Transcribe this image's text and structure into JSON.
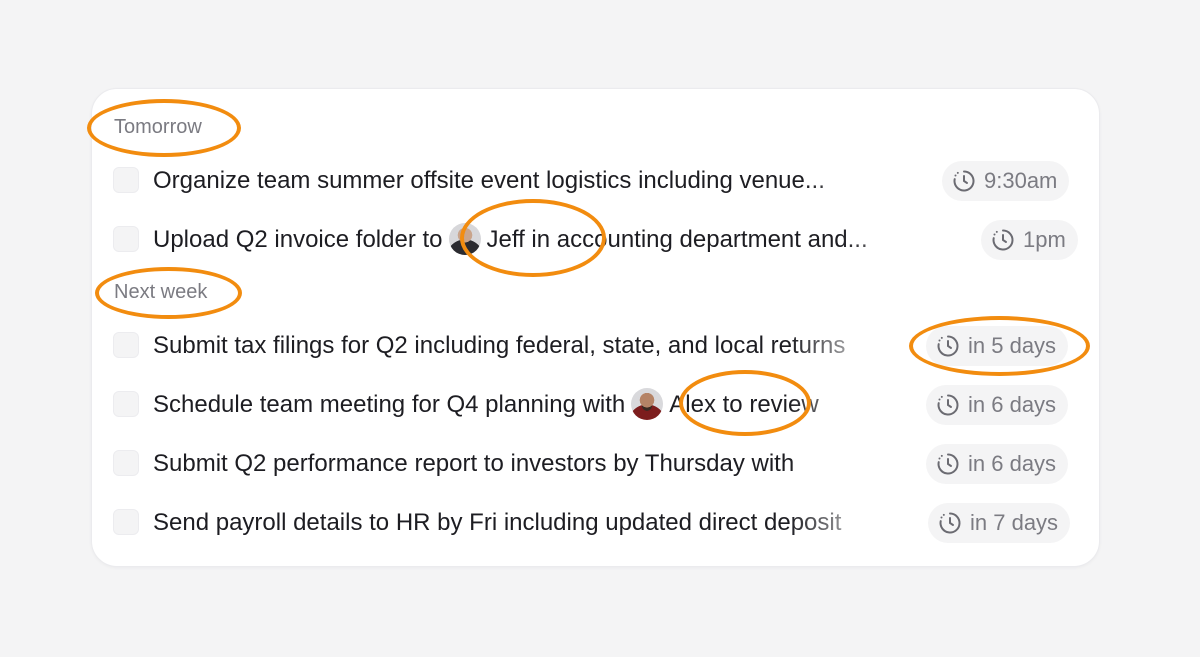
{
  "sections": [
    {
      "label": "Tomorrow",
      "tasks": [
        {
          "text": "Organize team summer offsite event logistics including venue...",
          "time": "9:30am",
          "clock_icon": "clock-icon"
        },
        {
          "text_before": "Upload Q2 invoice folder to",
          "mention": "Jeff",
          "text_after": "in accounting department and...",
          "time": "1pm",
          "clock_icon": "clock-icon"
        }
      ]
    },
    {
      "label": "Next week",
      "tasks": [
        {
          "text": "Submit tax filings for Q2 including federal, state, and local returns",
          "time": "in 5 days",
          "clock_icon": "clock-icon"
        },
        {
          "text_before": "Schedule team meeting for Q4 planning with",
          "mention": "Alex",
          "text_after": "to review",
          "time": "in 6 days",
          "clock_icon": "clock-icon"
        },
        {
          "text": "Submit Q2 performance report to investors by Thursday with",
          "time": "in 6 days",
          "clock_icon": "clock-icon"
        },
        {
          "text": "Send payroll details to HR by Fri including updated direct deposit",
          "time": "in 7 days",
          "clock_icon": "clock-icon"
        }
      ]
    }
  ],
  "colors": {
    "highlight_ring": "#f28c0f",
    "card_background": "#ffffff",
    "page_background": "#f4f4f5",
    "text_primary": "#1d1d22",
    "text_muted": "#7b7b82"
  }
}
